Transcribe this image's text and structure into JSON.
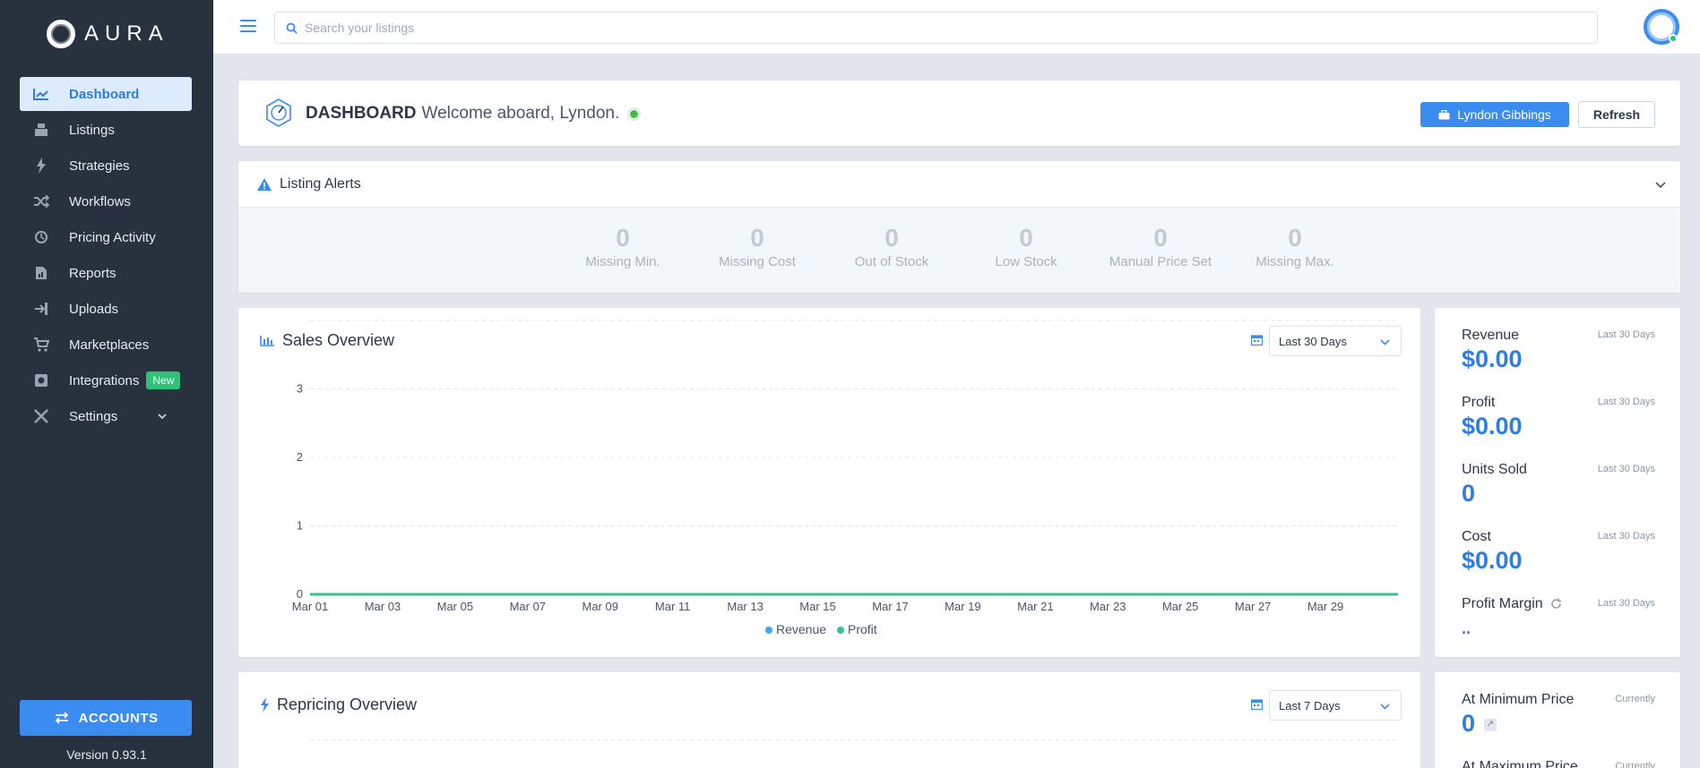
{
  "app": {
    "brand": "AURA",
    "version": "Version 0.93.1"
  },
  "sidebar": {
    "items": [
      {
        "label": "Dashboard",
        "icon": "trend-chart-icon"
      },
      {
        "label": "Listings",
        "icon": "boxes-icon"
      },
      {
        "label": "Strategies",
        "icon": "lightning-icon"
      },
      {
        "label": "Workflows",
        "icon": "shuffle-icon"
      },
      {
        "label": "Pricing Activity",
        "icon": "history-icon"
      },
      {
        "label": "Reports",
        "icon": "report-icon"
      },
      {
        "label": "Uploads",
        "icon": "upload-icon"
      },
      {
        "label": "Marketplaces",
        "icon": "cart-icon"
      },
      {
        "label": "Integrations",
        "icon": "plug-icon",
        "badge": "New"
      },
      {
        "label": "Settings",
        "icon": "tools-icon"
      }
    ],
    "accounts_label": "ACCOUNTS"
  },
  "topbar": {
    "search_placeholder": "Search your listings"
  },
  "header": {
    "title": "DASHBOARD",
    "welcome": "Welcome aboard, Lyndon.",
    "user_button": "Lyndon Gibbings",
    "refresh_button": "Refresh"
  },
  "alerts": {
    "title": "Listing Alerts",
    "stats": [
      {
        "value": "0",
        "label": "Missing Min."
      },
      {
        "value": "0",
        "label": "Missing Cost"
      },
      {
        "value": "0",
        "label": "Out of Stock"
      },
      {
        "value": "0",
        "label": "Low Stock"
      },
      {
        "value": "0",
        "label": "Manual Price Set"
      },
      {
        "value": "0",
        "label": "Missing Max."
      }
    ]
  },
  "sales": {
    "title": "Sales Overview",
    "range": "Last 30 Days"
  },
  "chart_data": {
    "type": "line",
    "title": "",
    "x": [
      "Mar 01",
      "Mar 03",
      "Mar 05",
      "Mar 07",
      "Mar 09",
      "Mar 11",
      "Mar 13",
      "Mar 15",
      "Mar 17",
      "Mar 19",
      "Mar 21",
      "Mar 23",
      "Mar 25",
      "Mar 27",
      "Mar 29"
    ],
    "yticks": [
      "0",
      "1",
      "2",
      "3"
    ],
    "ylim": [
      0,
      4
    ],
    "series": [
      {
        "name": "Revenue",
        "color": "#3ea8ee",
        "values": [
          0,
          0,
          0,
          0,
          0,
          0,
          0,
          0,
          0,
          0,
          0,
          0,
          0,
          0,
          0
        ]
      },
      {
        "name": "Profit",
        "color": "#33c58e",
        "values": [
          0,
          0,
          0,
          0,
          0,
          0,
          0,
          0,
          0,
          0,
          0,
          0,
          0,
          0,
          0
        ]
      }
    ],
    "grid": true,
    "legend_position": "bottom-center"
  },
  "stats": [
    {
      "name": "Revenue",
      "period": "Last 30 Days",
      "value": "$0.00"
    },
    {
      "name": "Profit",
      "period": "Last 30 Days",
      "value": "$0.00"
    },
    {
      "name": "Units Sold",
      "period": "Last 30 Days",
      "value": "0"
    },
    {
      "name": "Cost",
      "period": "Last 30 Days",
      "value": "$0.00"
    },
    {
      "name": "Profit Margin",
      "period": "Last 30 Days",
      "value": ".."
    }
  ],
  "repricing": {
    "title": "Repricing Overview",
    "range": "Last 7 Days"
  },
  "repricing_stats": [
    {
      "name": "At Minimum Price",
      "period": "Currently",
      "value": "0"
    },
    {
      "name": "At Maximum Price",
      "period": "Currently"
    }
  ],
  "colors": {
    "accent": "#3b8cf0",
    "sidebar": "#28323f",
    "success": "#2fc07a"
  }
}
